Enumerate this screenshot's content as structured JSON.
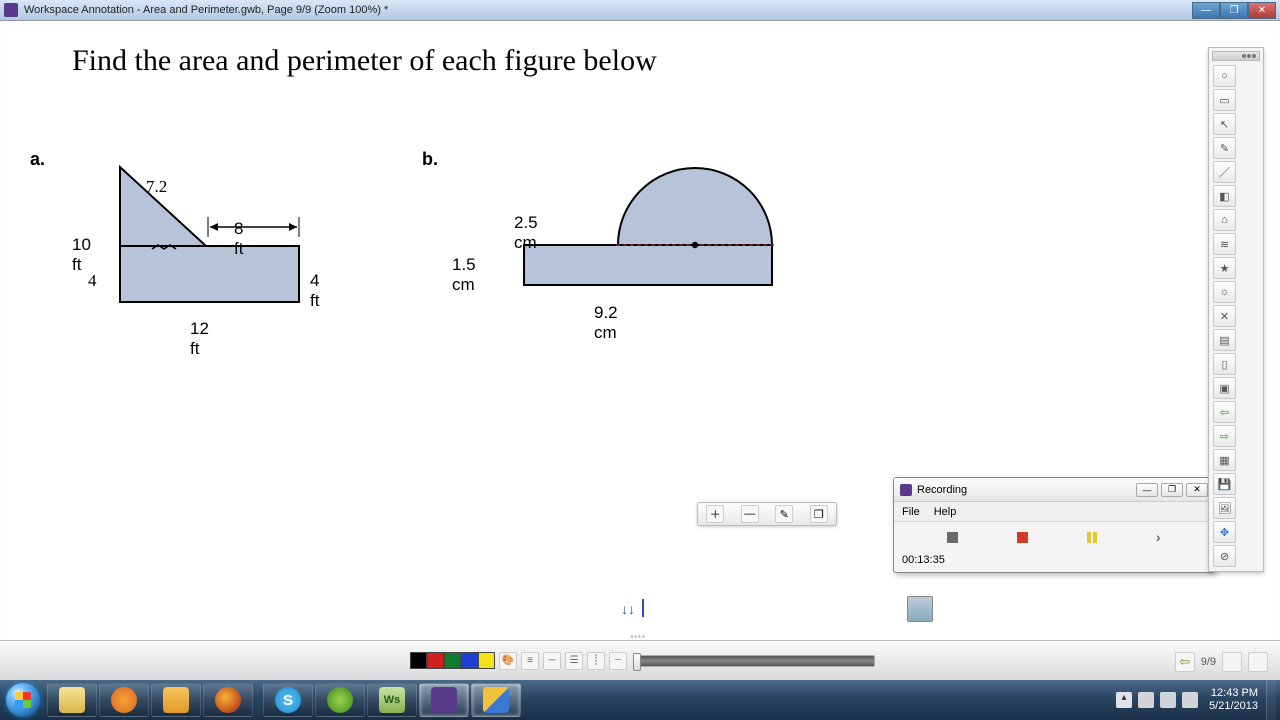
{
  "window": {
    "title": "Workspace Annotation - Area and Perimeter.gwb, Page 9/9  (Zoom 100%) *"
  },
  "prompt": "Find the area and  perimeter of each  figure below",
  "figureA": {
    "label": "a.",
    "dim_left": "10 ft",
    "dim_mark": "4",
    "dim_top": "8 ft",
    "dim_right": "4 ft",
    "dim_bottom": "12 ft",
    "handwritten": "7.2"
  },
  "figureB": {
    "label": "b.",
    "dim_diam": "2.5 cm",
    "dim_left": "1.5 cm",
    "dim_bottom": "9.2 cm"
  },
  "recording": {
    "title": "Recording",
    "menu_file": "File",
    "menu_help": "Help",
    "elapsed": "00:13:35"
  },
  "bottombar": {
    "page": "9/9"
  },
  "palette": [
    "#000000",
    "#d21f1f",
    "#107a2f",
    "#1f3fd2",
    "#f3e11b"
  ],
  "taskbar": {
    "time": "12:43 PM",
    "date": "5/21/2013"
  }
}
